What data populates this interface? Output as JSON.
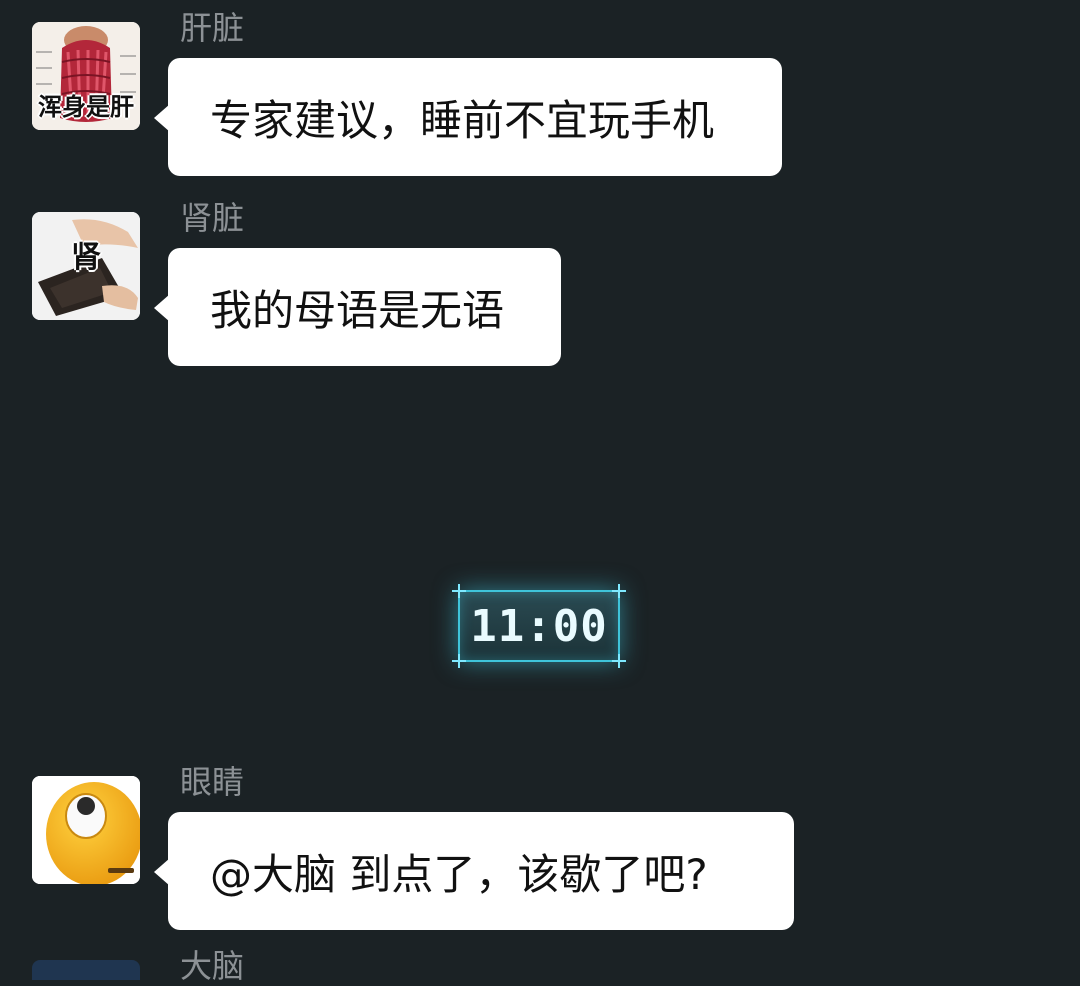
{
  "messages": [
    {
      "sender": "肝脏",
      "text": "专家建议，睡前不宜玩手机",
      "avatar_caption": "浑身是肝",
      "avatar_icon": "liver-anatomy-avatar"
    },
    {
      "sender": "肾脏",
      "text": "我的母语是无语",
      "avatar_caption": "肾",
      "avatar_icon": "kidney-wallet-avatar"
    },
    {
      "sender": "眼睛",
      "text": "@大脑 到点了，该歇了吧?",
      "avatar_icon": "eye-roll-emoji-avatar"
    }
  ],
  "time_divider": "11:00",
  "next_sender": "大脑",
  "colors": {
    "background": "#1b2225",
    "bubble": "#ffffff",
    "sender_name": "#8c9195",
    "clock_glow": "#3fc4da"
  }
}
